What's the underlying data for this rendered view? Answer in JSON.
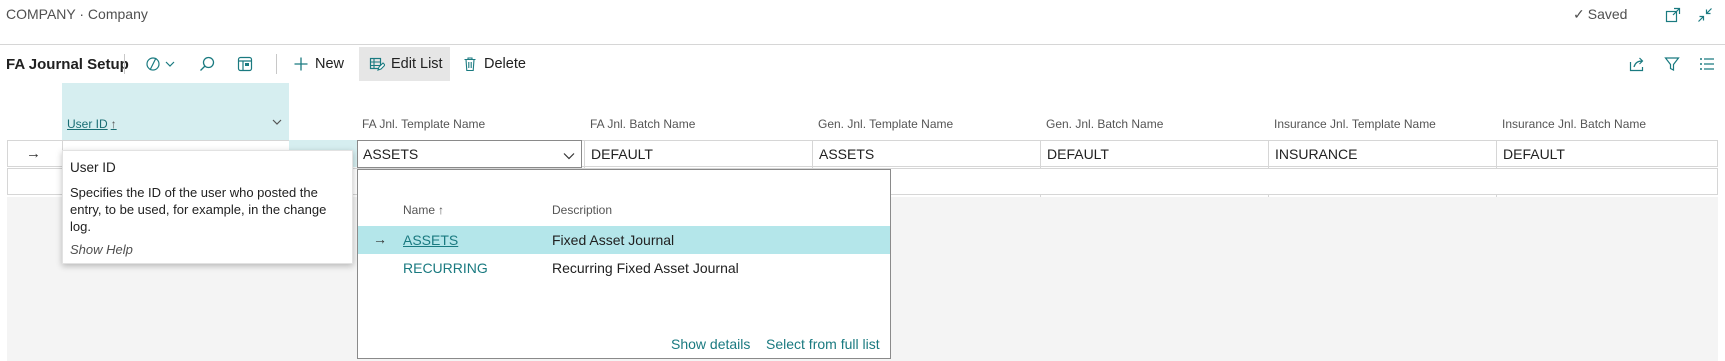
{
  "header": {
    "breadcrumb": "COMPANY · Company",
    "saved_label": "Saved"
  },
  "toolbar": {
    "page_title": "FA Journal Setup",
    "new_label": "New",
    "edit_list_label": "Edit List",
    "delete_label": "Delete"
  },
  "table": {
    "columns": [
      "User ID",
      "FA Jnl. Template Name",
      "FA Jnl. Batch Name",
      "Gen. Jnl. Template Name",
      "Gen. Jnl. Batch Name",
      "Insurance Jnl. Template Name",
      "Insurance Jnl. Batch Name"
    ],
    "rows": [
      {
        "user_id": "",
        "fa_template": "ASSETS",
        "fa_batch": "DEFAULT",
        "gen_template": "ASSETS",
        "gen_batch": "DEFAULT",
        "ins_template": "INSURANCE",
        "ins_batch": "DEFAULT"
      }
    ]
  },
  "tooltip": {
    "title": "User ID",
    "body": "Specifies the ID of the user who posted the entry, to be used, for example, in the change log.",
    "help": "Show Help"
  },
  "lookup": {
    "name_header": "Name",
    "desc_header": "Description",
    "items": [
      {
        "name": "ASSETS",
        "description": "Fixed Asset Journal"
      },
      {
        "name": "RECURRING",
        "description": "Recurring Fixed Asset Journal"
      }
    ],
    "show_details": "Show details",
    "select_full": "Select from full list"
  },
  "icons": {
    "sort_up": "arrow-up-icon",
    "row_arrow": "arrow-right-icon"
  },
  "colors": {
    "accent": "#1a7a80",
    "selected_row": "#b4e6ea",
    "selected_column": "#d6eef0"
  }
}
